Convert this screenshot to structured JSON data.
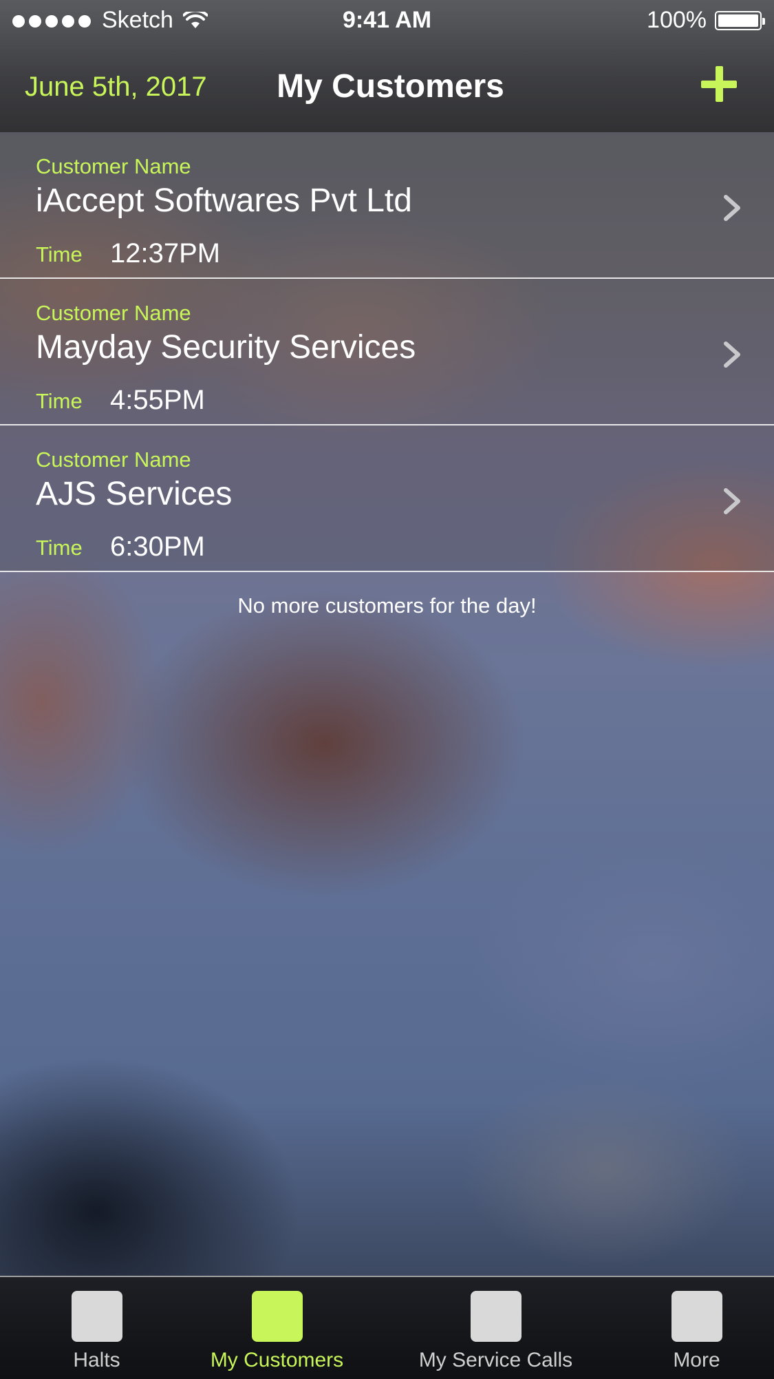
{
  "status_bar": {
    "carrier": "Sketch",
    "time": "9:41 AM",
    "battery": "100%"
  },
  "nav": {
    "date": "June 5th, 2017",
    "title": "My Customers",
    "add_icon": "plus-icon"
  },
  "customers": [
    {
      "label": "Customer Name",
      "name": "iAccept Softwares Pvt Ltd",
      "time_label": "Time",
      "time": "12:37PM"
    },
    {
      "label": "Customer Name",
      "name": "Mayday Security Services",
      "time_label": "Time",
      "time": "4:55PM"
    },
    {
      "label": "Customer Name",
      "name": "AJS Services",
      "time_label": "Time",
      "time": "6:30PM"
    }
  ],
  "empty_message": "No more customers for the day!",
  "tabs": [
    {
      "label": "Halts",
      "active": false
    },
    {
      "label": "My Customers",
      "active": true
    },
    {
      "label": "My Service Calls",
      "active": false
    },
    {
      "label": "More",
      "active": false
    }
  ],
  "colors": {
    "accent": "#c8f55a",
    "tab_icon_inactive": "#d9d9d9"
  }
}
